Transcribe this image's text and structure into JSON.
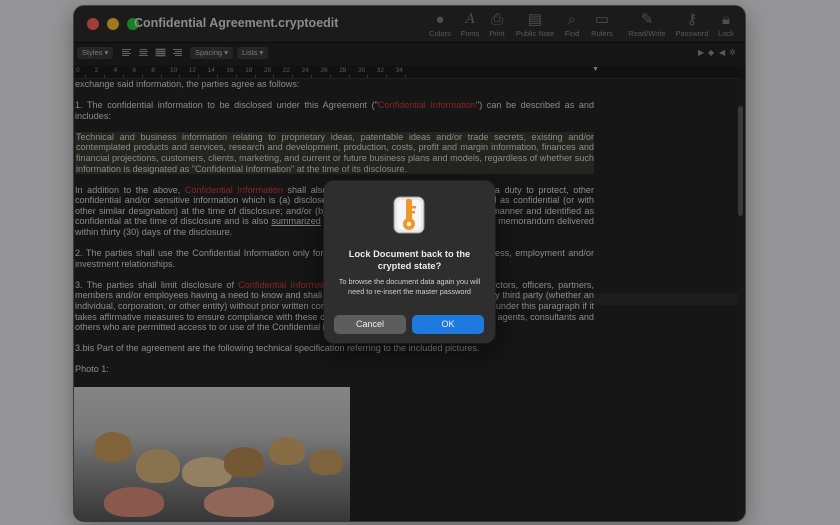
{
  "window": {
    "title": "Confidential Agreement.cryptoedit"
  },
  "toolbar": {
    "items": [
      {
        "label": "Colors",
        "icon": "color-wheel-icon"
      },
      {
        "label": "Fonts",
        "icon": "font-icon"
      },
      {
        "label": "Print",
        "icon": "printer-icon"
      },
      {
        "label": "Public Note",
        "icon": "note-icon"
      },
      {
        "label": "Find",
        "icon": "magnifier-icon"
      },
      {
        "label": "Rulers",
        "icon": "ruler-icon"
      },
      {
        "label": "Read/Write",
        "icon": "pencil-icon"
      },
      {
        "label": "Password",
        "icon": "key-icon"
      },
      {
        "label": "Lock",
        "icon": "lock-icon"
      }
    ]
  },
  "formatbar": {
    "styles": "Styles",
    "spacing": "Spacing",
    "lists": "Lists"
  },
  "ruler": {
    "labels": [
      "0",
      "2",
      "4",
      "6",
      "8",
      "10",
      "12",
      "14",
      "16",
      "18",
      "20",
      "22",
      "24",
      "26",
      "28",
      "30",
      "32",
      "34"
    ]
  },
  "document": {
    "line0": "exchange said information, the parties agree as follows:",
    "p1_a": "1. The confidential information to be disclosed under this Agreement (\"",
    "p1_red": "Confidential Information",
    "p1_b": "\") can be described as and includes:",
    "p2": "Technical and business information relating to proprietary ideas, patentable ideas and/or trade secrets, existing and/or contemplated products and services, research and development, production, costs, profit and margin information, finances and financial projections, customers, clients, marketing, and current or future business plans and models, regardless of whether such information is designated as \"Confidential Information\" at the time of its disclosure.",
    "p3_a": "In addition to the above, ",
    "p3_red": "Confidential Information",
    "p3_b": " shall also include, and the Recipient shall have a duty to protect, other confidential and/or sensitive information which is (a) disclosed by the Discloser in writing and marked as confidential (or with other similar designation) at the time of disclosure; and/or (b) disclosed by the Discloser in any other manner and identified as confidential at the time of disclosure and is also ",
    "p3_u": "summarized",
    "p3_c": " and designated as confidential in a written memorandum delivered within thirty (30) days of the disclosure.",
    "p4": "2. The parties shall use the Confidential Information only for the purpose of evaluating potential business, employment and/or investment relationships.",
    "p5_a": "3. The parties shall limit disclosure of ",
    "p5_red": "Confidential Information",
    "p5_b": " within its own organization to its directors, officers, partners, members and/or employees having a need to know and shall not disclose Confidential Information to any third party (whether an individual, corporation, or other entity) without prior written consent. Recipient shall satisfy its obligations under this paragraph if it takes affirmative measures to ensure compliance with these confidentiality obligations by its employees, agents, consultants and others who are permitted access to or use of the Confidential Information.",
    "p6": "3.bis  Part of the agreement are the following technical specification referring to the included pictures.",
    "p7": "Photo 1:"
  },
  "dialog": {
    "icon": "key-lock-app-icon",
    "title": "Lock Document back to the crypted state?",
    "message": "To browse the document data again you will need to re-insert the master password",
    "cancel_label": "Cancel",
    "ok_label": "OK"
  },
  "colors": {
    "accent": "#1f7ae0",
    "highlight_red": "#d23a3a",
    "background": "#232323"
  }
}
